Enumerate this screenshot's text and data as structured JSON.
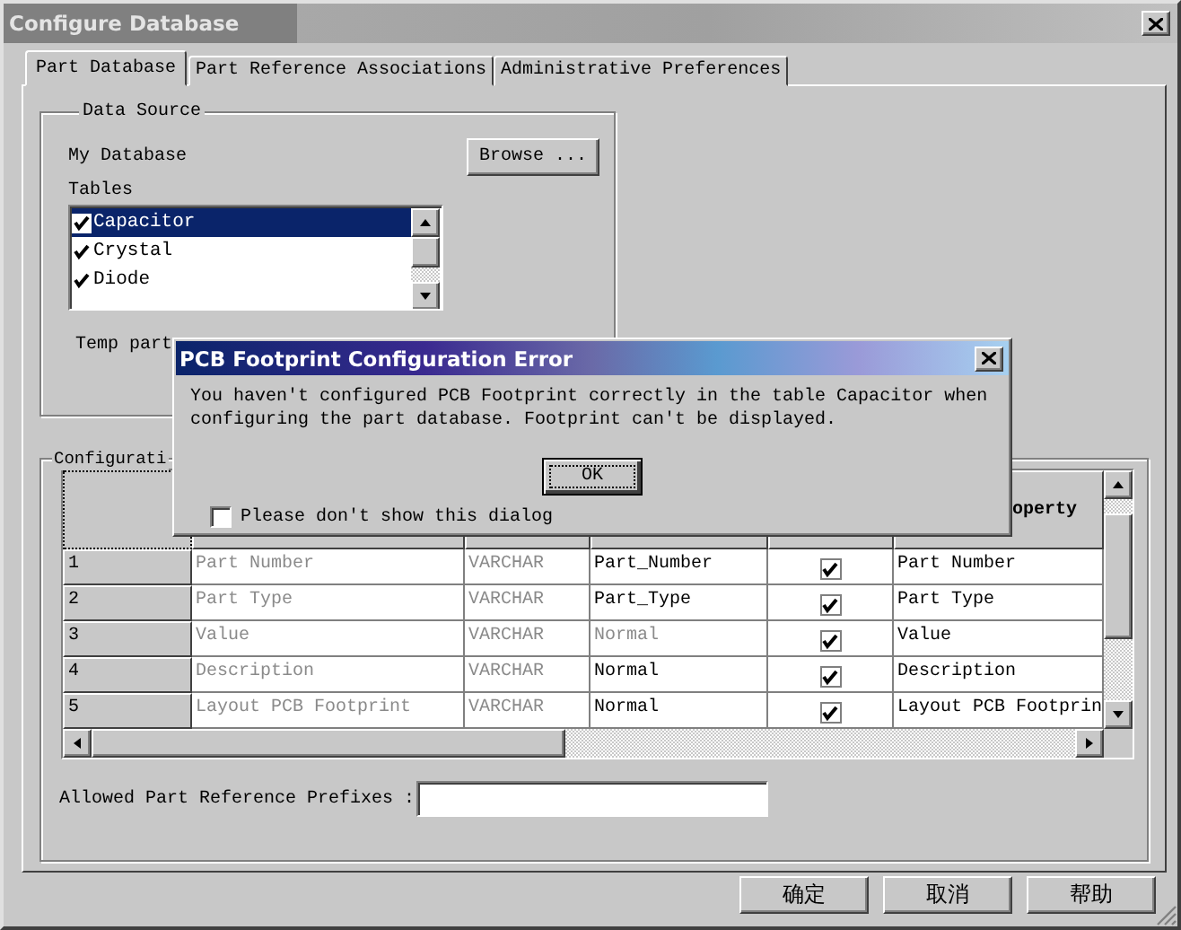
{
  "window": {
    "title": "Configure Database",
    "active": false
  },
  "tabs": [
    {
      "label": "Part Database",
      "selected": true
    },
    {
      "label": "Part Reference Associations",
      "selected": false
    },
    {
      "label": "Administrative Preferences",
      "selected": false
    }
  ],
  "data_source": {
    "title": "Data Source",
    "database_label": "My Database",
    "browse_button": "Browse ...",
    "tables_label": "Tables",
    "tables": [
      {
        "name": "Capacitor",
        "checked": true,
        "selected": true
      },
      {
        "name": "Crystal",
        "checked": true,
        "selected": false
      },
      {
        "name": "Diode",
        "checked": true,
        "selected": false
      }
    ],
    "temp_label": "Temp part"
  },
  "configuration": {
    "title": "Configurati",
    "headers": {
      "column_6": "operty"
    },
    "rows": [
      {
        "number": "1",
        "name": "Part Number",
        "type": "VARCHAR",
        "value": "Part_Number",
        "value_disabled": false,
        "checked": true,
        "property": "Part Number"
      },
      {
        "number": "2",
        "name": "Part Type",
        "type": "VARCHAR",
        "value": "Part_Type",
        "value_disabled": false,
        "checked": true,
        "property": "Part Type"
      },
      {
        "number": "3",
        "name": "Value",
        "type": "VARCHAR",
        "value": "Normal",
        "value_disabled": true,
        "checked": true,
        "property": "Value"
      },
      {
        "number": "4",
        "name": "Description",
        "type": "VARCHAR",
        "value": "Normal",
        "value_disabled": false,
        "checked": true,
        "property": "Description"
      },
      {
        "number": "5",
        "name": "Layout PCB Footprint",
        "type": "VARCHAR",
        "value": "Normal",
        "value_disabled": false,
        "checked": true,
        "property": "Layout PCB Footprin"
      }
    ]
  },
  "prefixes": {
    "label": "Allowed Part Reference Prefixes :"
  },
  "buttons": [
    "确定",
    "取消",
    "帮助"
  ],
  "dialog": {
    "title": "PCB Footprint Configuration Error",
    "message": "You haven't configured PCB Footprint correctly in the table Capacitor when configuring the part database. Footprint can't be displayed.",
    "ok_button": "OK",
    "dont_show": {
      "label": "Please don't show this dialog",
      "checked": false
    }
  }
}
